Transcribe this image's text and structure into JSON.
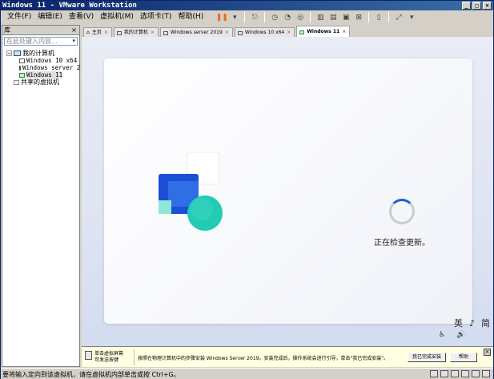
{
  "window": {
    "title": "Windows 11 - VMware Workstation"
  },
  "menu": [
    "文件(F)",
    "编辑(E)",
    "查看(V)",
    "虚拟机(M)",
    "选项卡(T)",
    "帮助(H)"
  ],
  "library": {
    "title": "库",
    "search_placeholder": "在此处键入内容...",
    "tree": {
      "root": "我的计算机",
      "vms": [
        "Windows 10 x64",
        "Windows server 2",
        "Windows 11"
      ],
      "shared": "共享的虚拟机"
    }
  },
  "tabs": [
    {
      "label": "主页"
    },
    {
      "label": "我的计算机"
    },
    {
      "label": "Windows server 2019"
    },
    {
      "label": "Windows 10 x64"
    },
    {
      "label": "Windows 11",
      "active": true
    }
  ],
  "vm_screen": {
    "status": "正在检查更新。",
    "ime_chars": [
      "英",
      "♪",
      "简"
    ]
  },
  "hint": {
    "left_line1": "单击虚拟屏幕",
    "left_line2": "可发送按键",
    "message": "按照在物理计算机中的步骤安装 Windows Server 2019。安装完成后，操作系统会进行引导，单击\"我已完成安装\"。",
    "done_button": "我已完成安装",
    "help_button": "帮助"
  },
  "statusbar": {
    "text": "要将输入定向到该虚拟机，请在虚拟机内部单击或按 Ctrl+G。"
  },
  "colors": {
    "title_bg": "#0a246a",
    "pause_orange": "#e86b1a",
    "spinner_blue": "#1a64c8",
    "hint_bg": "#ffffe1"
  }
}
